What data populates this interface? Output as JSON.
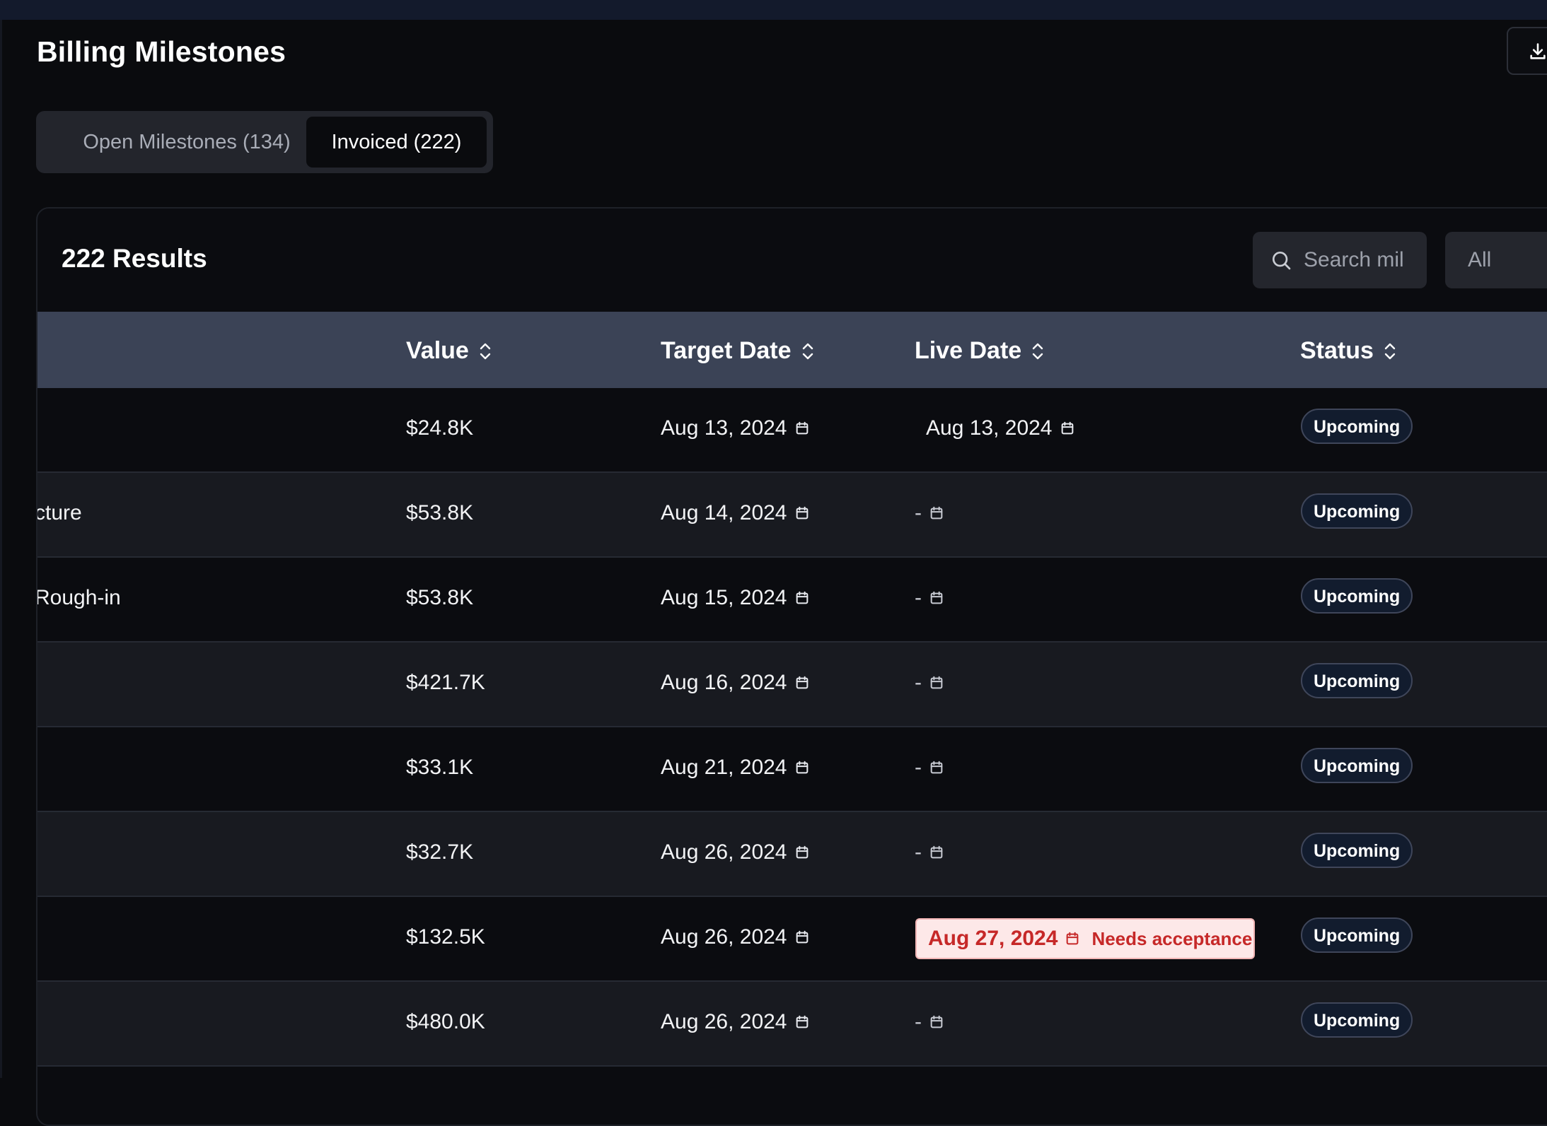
{
  "page": {
    "title": "Billing Milestones"
  },
  "tabs": [
    {
      "label": "Open Milestones (134)",
      "active": false
    },
    {
      "label": "Invoiced (222)",
      "active": true
    }
  ],
  "toolbar": {
    "results": "222 Results",
    "search_text": "Search mil",
    "filter_value": "All",
    "download_icon": "download-icon"
  },
  "columns": {
    "value": "Value",
    "target_date": "Target Date",
    "live_date": "Live Date",
    "status": "Status"
  },
  "rows": [
    {
      "name": "",
      "value": "$24.8K",
      "target_date": "Aug 13, 2024",
      "live_date": "Aug 13, 2024",
      "status": "Upcoming"
    },
    {
      "name": "cture",
      "value": "$53.8K",
      "target_date": "Aug 14, 2024",
      "live_date": "-",
      "status": "Upcoming"
    },
    {
      "name": "Rough-in",
      "value": "$53.8K",
      "target_date": "Aug 15, 2024",
      "live_date": "-",
      "status": "Upcoming"
    },
    {
      "name": "",
      "value": "$421.7K",
      "target_date": "Aug 16, 2024",
      "live_date": "-",
      "status": "Upcoming"
    },
    {
      "name": "",
      "value": "$33.1K",
      "target_date": "Aug 21, 2024",
      "live_date": "-",
      "status": "Upcoming"
    },
    {
      "name": "",
      "value": "$32.7K",
      "target_date": "Aug 26, 2024",
      "live_date": "-",
      "status": "Upcoming"
    },
    {
      "name": "",
      "value": "$132.5K",
      "target_date": "Aug 26, 2024",
      "live_date": "Aug 27, 2024",
      "live_date_note": "Needs acceptance",
      "status": "Upcoming"
    },
    {
      "name": "",
      "value": "$480.0K",
      "target_date": "Aug 26, 2024",
      "live_date": "-",
      "status": "Upcoming"
    }
  ],
  "colors": {
    "background": "#0a0b0e",
    "header": "#3b4356",
    "alert_bg": "#fde8e8",
    "alert_text": "#c62828"
  }
}
